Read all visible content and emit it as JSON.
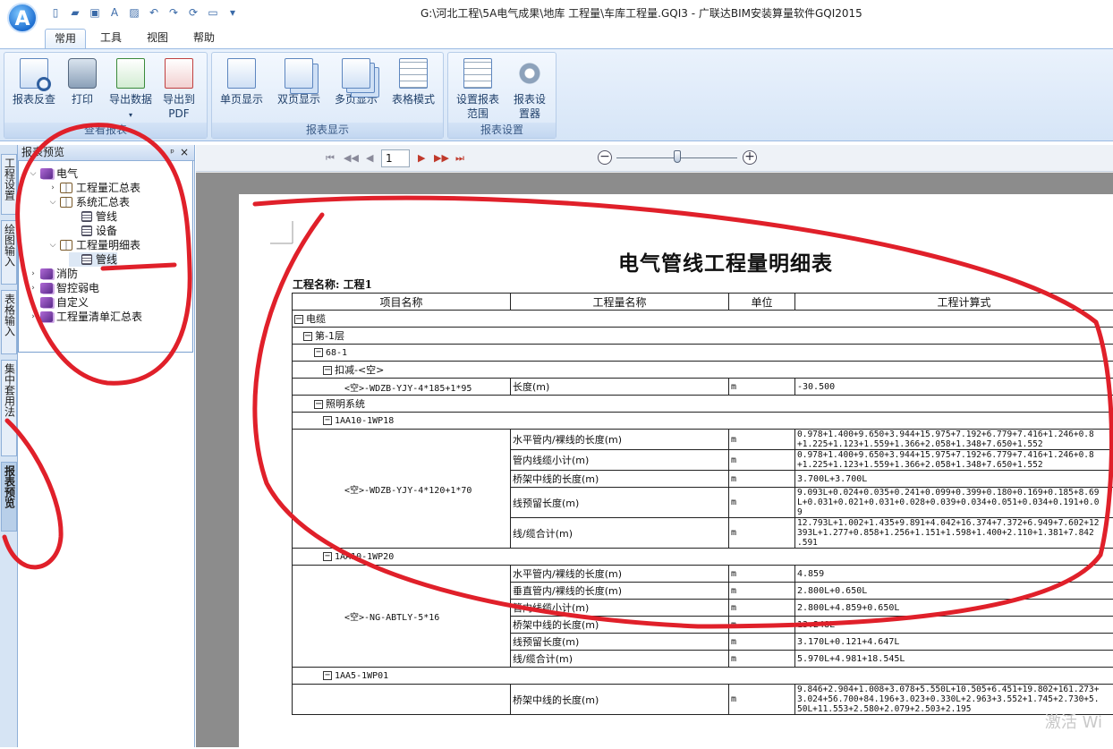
{
  "app": {
    "logo_letter": "A",
    "window_title": "G:\\河北工程\\5A电气成果\\地库  工程量\\车库工程量.GQI3 - 广联达BIM安装算量软件GQI2015"
  },
  "ribbon_tabs": [
    "常用",
    "工具",
    "视图",
    "帮助"
  ],
  "ribbon_groups": [
    {
      "label": "查看报表",
      "buttons": [
        "报表反查",
        "打印",
        "导出数据",
        "导出到PDF"
      ]
    },
    {
      "label": "报表显示",
      "buttons": [
        "单页显示",
        "双页显示",
        "多页显示",
        "表格模式"
      ]
    },
    {
      "label": "报表设置",
      "buttons": [
        "设置报表范围",
        "报表设置器"
      ]
    }
  ],
  "left_tabs": [
    "工程设置",
    "绘图输入",
    "表格输入",
    "集中套用法",
    "报表预览"
  ],
  "panel": {
    "title": "报表预览",
    "pin": "ᵖ",
    "close": "×"
  },
  "tree": [
    {
      "label": "电气",
      "level": 0,
      "expander": "⌵",
      "icon": "purple"
    },
    {
      "label": "工程量汇总表",
      "level": 1,
      "expander": "›",
      "icon": "open"
    },
    {
      "label": "系统汇总表",
      "level": 1,
      "expander": "⌵",
      "icon": "open"
    },
    {
      "label": "管线",
      "level": 2,
      "expander": "",
      "icon": "sheet"
    },
    {
      "label": "设备",
      "level": 2,
      "expander": "",
      "icon": "sheet"
    },
    {
      "label": "工程量明细表",
      "level": 1,
      "expander": "⌵",
      "icon": "open"
    },
    {
      "label": "管线",
      "level": 2,
      "expander": "",
      "icon": "sheet",
      "selected": true
    },
    {
      "label": "消防",
      "level": 0,
      "expander": "›",
      "icon": "purple"
    },
    {
      "label": "智控弱电",
      "level": 0,
      "expander": "›",
      "icon": "purple"
    },
    {
      "label": "自定义",
      "level": 0,
      "expander": "›",
      "icon": "purple"
    },
    {
      "label": "工程量清单汇总表",
      "level": 0,
      "expander": "›",
      "icon": "purple"
    }
  ],
  "navigator": {
    "page": "1",
    "first": "⏮",
    "prev": "◀◀",
    "next": "▶",
    "next_fast": "▶▶",
    "last": "⏭",
    "zoom_out": "−",
    "zoom_in": "+"
  },
  "report": {
    "title": "电气管线工程量明细表",
    "project_label": "工程名称: 工程1",
    "headers": [
      "项目名称",
      "工程量名称",
      "单位",
      "工程计算式"
    ]
  },
  "labels": {
    "cable": "电缆",
    "floor1": "第-1层",
    "c68": "68-1",
    "deduct": "扣减-<空>",
    "deduct_item": "<空>-WDZB-YJY-4*185+1*95",
    "lighting": "照明系统",
    "wp18": "1AA10-1WP18",
    "wp18_item": "<空>-WDZB-YJY-4*120+1*70",
    "wp20": "1AA10-1WP20",
    "wp20_item": "<空>-NG-ABTLY-5*16",
    "wp01": "1AA5-1WP01"
  },
  "rows": {
    "deduct": {
      "q": "长度(m)",
      "u": "m",
      "f": "-30.500"
    },
    "wp18": [
      {
        "q": "水平管内/裸线的长度(m)",
        "u": "m",
        "f": "0.978+1.400+9.650+3.944+15.975+7.192+6.779+7.416+1.246+0.8",
        "f2": "+1.225+1.123+1.559+1.366+2.058+1.348+7.650+1.552"
      },
      {
        "q": "管内线缆小计(m)",
        "u": "m",
        "f": "0.978+1.400+9.650+3.944+15.975+7.192+6.779+7.416+1.246+0.8",
        "f2": "+1.225+1.123+1.559+1.366+2.058+1.348+7.650+1.552"
      },
      {
        "q": "桥架中线的长度(m)",
        "u": "m",
        "f": "3.700L+3.700L"
      },
      {
        "q": "线预留长度(m)",
        "u": "m",
        "f": "9.093L+0.024+0.035+0.241+0.099+0.399+0.180+0.169+0.185+8.69",
        "f2": "L+0.031+0.021+0.031+0.028+0.039+0.034+0.051+0.034+0.191+0.0",
        "f3": "9"
      },
      {
        "q": "线/缆合计(m)",
        "u": "m",
        "f": "12.793L+1.002+1.435+9.891+4.042+16.374+7.372+6.949+7.602+12",
        "f2": "393L+1.277+0.858+1.256+1.151+1.598+1.400+2.110+1.381+7.842",
        "f3": ".591"
      }
    ],
    "wp20": [
      {
        "q": "水平管内/裸线的长度(m)",
        "u": "m",
        "f": "4.859"
      },
      {
        "q": "垂直管内/裸线的长度(m)",
        "u": "m",
        "f": "2.800L+0.650L"
      },
      {
        "q": "管内线缆小计(m)",
        "u": "m",
        "f": "2.800L+4.859+0.650L"
      },
      {
        "q": "桥架中线的长度(m)",
        "u": "m",
        "f": "13.248L"
      },
      {
        "q": "线预留长度(m)",
        "u": "m",
        "f": "3.170L+0.121+4.647L"
      },
      {
        "q": "线/缆合计(m)",
        "u": "m",
        "f": "5.970L+4.981+18.545L"
      }
    ],
    "wp01": {
      "q": "桥架中线的长度(m)",
      "u": "m",
      "f": "9.846+2.904+1.008+3.078+5.550L+10.505+6.451+19.802+161.273+",
      "f2": "3.024+56.700+84.196+3.023+0.330L+2.963+3.552+1.745+2.730+5.",
      "f3": "50L+11.553+2.580+2.079+2.503+2.195"
    }
  },
  "watermark": "激活 Wi"
}
